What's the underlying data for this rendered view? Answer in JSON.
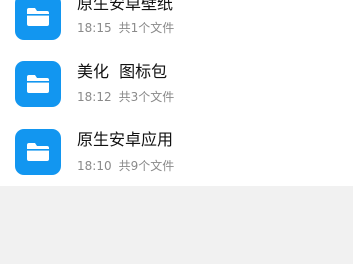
{
  "folders": [
    {
      "name": "原生安卓壁纸",
      "time": "18:15",
      "count": "共1个文件",
      "icon": "folder-icon"
    },
    {
      "name": "美化  图标包",
      "time": "18:12",
      "count": "共3个文件",
      "icon": "folder-icon"
    },
    {
      "name": "原生安卓应用",
      "time": "18:10",
      "count": "共9个文件",
      "icon": "folder-icon"
    }
  ],
  "colors": {
    "folder_icon_bg": "#1296f0",
    "page_bg": "#f1f1f1",
    "list_bg": "#ffffff"
  }
}
